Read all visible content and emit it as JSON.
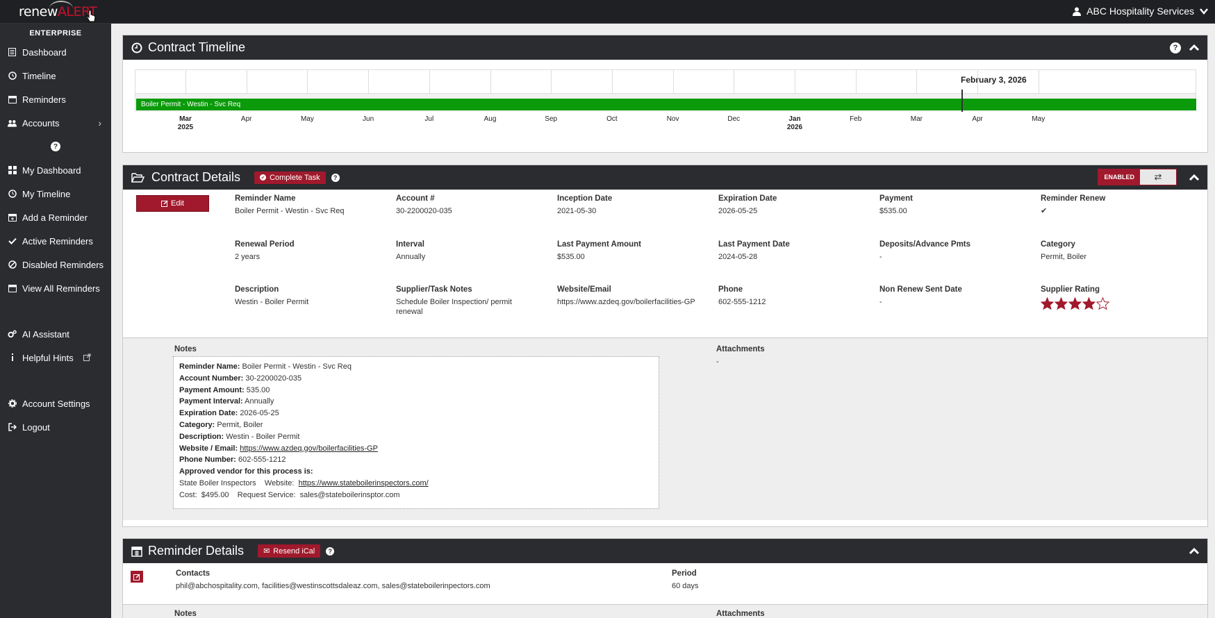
{
  "app": {
    "logo_left": "renew",
    "logo_right": "ALERT",
    "user_name": "ABC Hospitality Services"
  },
  "sidebar": {
    "tier": "ENTERPRISE",
    "help": "?",
    "items": [
      {
        "label": "Dashboard",
        "icon": "dashboard-icon"
      },
      {
        "label": "Timeline",
        "icon": "clock-icon"
      },
      {
        "label": "Reminders",
        "icon": "calendar-icon"
      },
      {
        "label": "Accounts",
        "icon": "users-icon"
      },
      {
        "label": "My Dashboard",
        "icon": "grid-icon"
      },
      {
        "label": "My Timeline",
        "icon": "clock-icon"
      },
      {
        "label": "Add a Reminder",
        "icon": "calendar-plus-icon"
      },
      {
        "label": "Active Reminders",
        "icon": "check-icon"
      },
      {
        "label": "Disabled Reminders",
        "icon": "ban-icon"
      },
      {
        "label": "View All Reminders",
        "icon": "calendar-icon"
      },
      {
        "label": "AI Assistant",
        "icon": "gears-icon"
      },
      {
        "label": "Helpful Hints",
        "icon": "info-icon"
      },
      {
        "label": "Account Settings",
        "icon": "gear-icon"
      },
      {
        "label": "Logout",
        "icon": "logout-icon"
      }
    ]
  },
  "timeline_panel": {
    "title": "Contract Timeline",
    "today_label": "February 3, 2026",
    "bar_label": "Boiler Permit - Westin - Svc Req",
    "months": [
      {
        "m": "Mar",
        "y": "2025"
      },
      {
        "m": "Apr",
        "y": ""
      },
      {
        "m": "May",
        "y": ""
      },
      {
        "m": "Jun",
        "y": ""
      },
      {
        "m": "Jul",
        "y": ""
      },
      {
        "m": "Aug",
        "y": ""
      },
      {
        "m": "Sep",
        "y": ""
      },
      {
        "m": "Oct",
        "y": ""
      },
      {
        "m": "Nov",
        "y": ""
      },
      {
        "m": "Dec",
        "y": ""
      },
      {
        "m": "Jan",
        "y": "2026"
      },
      {
        "m": "Feb",
        "y": ""
      },
      {
        "m": "Mar",
        "y": ""
      },
      {
        "m": "Apr",
        "y": ""
      },
      {
        "m": "May",
        "y": ""
      }
    ]
  },
  "details_panel": {
    "title": "Contract Details",
    "complete_task": "Complete Task",
    "enabled": "ENABLED",
    "edit": "Edit",
    "fields": {
      "reminder_name": {
        "label": "Reminder Name",
        "value": "Boiler Permit - Westin - Svc Req"
      },
      "account": {
        "label": "Account #",
        "value": "30-2200020-035"
      },
      "inception": {
        "label": "Inception Date",
        "value": "2021-05-30"
      },
      "expiration": {
        "label": "Expiration Date",
        "value": "2026-05-25"
      },
      "payment": {
        "label": "Payment",
        "value": "$535.00"
      },
      "reminder_renew": {
        "label": "Reminder Renew",
        "value": "✔"
      },
      "renewal_period": {
        "label": "Renewal Period",
        "value": "2 years"
      },
      "interval": {
        "label": "Interval",
        "value": "Annually"
      },
      "last_payment_amount": {
        "label": "Last Payment Amount",
        "value": "$535.00"
      },
      "last_payment_date": {
        "label": "Last Payment Date",
        "value": "2024-05-28"
      },
      "deposits": {
        "label": "Deposits/Advance Pmts",
        "value": "-"
      },
      "category": {
        "label": "Category",
        "value": "Permit, Boiler"
      },
      "description": {
        "label": "Description",
        "value": "Westin - Boiler Permit"
      },
      "supplier_notes": {
        "label": "Supplier/Task Notes",
        "value": "Schedule Boiler Inspection/ permit renewal"
      },
      "website": {
        "label": "Website/Email",
        "value": "https://www.azdeq.gov/boilerfacilities-GP"
      },
      "phone": {
        "label": "Phone",
        "value": "602-555-1212"
      },
      "non_renew": {
        "label": "Non Renew Sent Date",
        "value": "-"
      },
      "rating": {
        "label": "Supplier Rating",
        "stars": 4,
        "max": 5
      }
    },
    "notes_label": "Notes",
    "attachments_label": "Attachments",
    "attachments_value": "-",
    "notes": {
      "l1k": "Reminder Name:",
      "l1v": " Boiler Permit - Westin - Svc Req",
      "l2k": "Account Number:",
      "l2v": " 30-2200020-035",
      "l3k": "Payment Amount:",
      "l3v": " 535.00",
      "l4k": "Payment Interval:",
      "l4v": " Annually",
      "l5k": "Expiration Date:",
      "l5v": " 2026-05-25",
      "l6k": "Category:",
      "l6v": " Permit, Boiler",
      "l7k": "Description:",
      "l7v": " Westin - Boiler Permit",
      "l8k": "Website / Email:",
      "l8v": "https://www.azdeq.gov/boilerfacilities-GP",
      "l9k": "Phone Number:",
      "l9v": " 602-555-1212",
      "l10k": "Approved vendor for this process is:",
      "l11a": "State Boiler Inspectors    Website:  ",
      "l11b": "https://www.stateboilerinspectors.com/",
      "l12": "Cost:  $495.00    Request Service:  sales@stateboilerinsptor.com"
    }
  },
  "reminder_panel": {
    "title": "Reminder Details",
    "resend": "Resend iCal",
    "contacts_label": "Contacts",
    "contacts_value": "phil@abchospitality.com, facilities@westinscottsdaleaz.com, sales@stateboilerinpectors.com",
    "period_label": "Period",
    "period_value": "60 days",
    "notes_label": "Notes",
    "attachments_label": "Attachments"
  },
  "colors": {
    "brand": "#a0192c",
    "dark": "#2b2c30",
    "timeline_bar": "#0a9a0a"
  }
}
